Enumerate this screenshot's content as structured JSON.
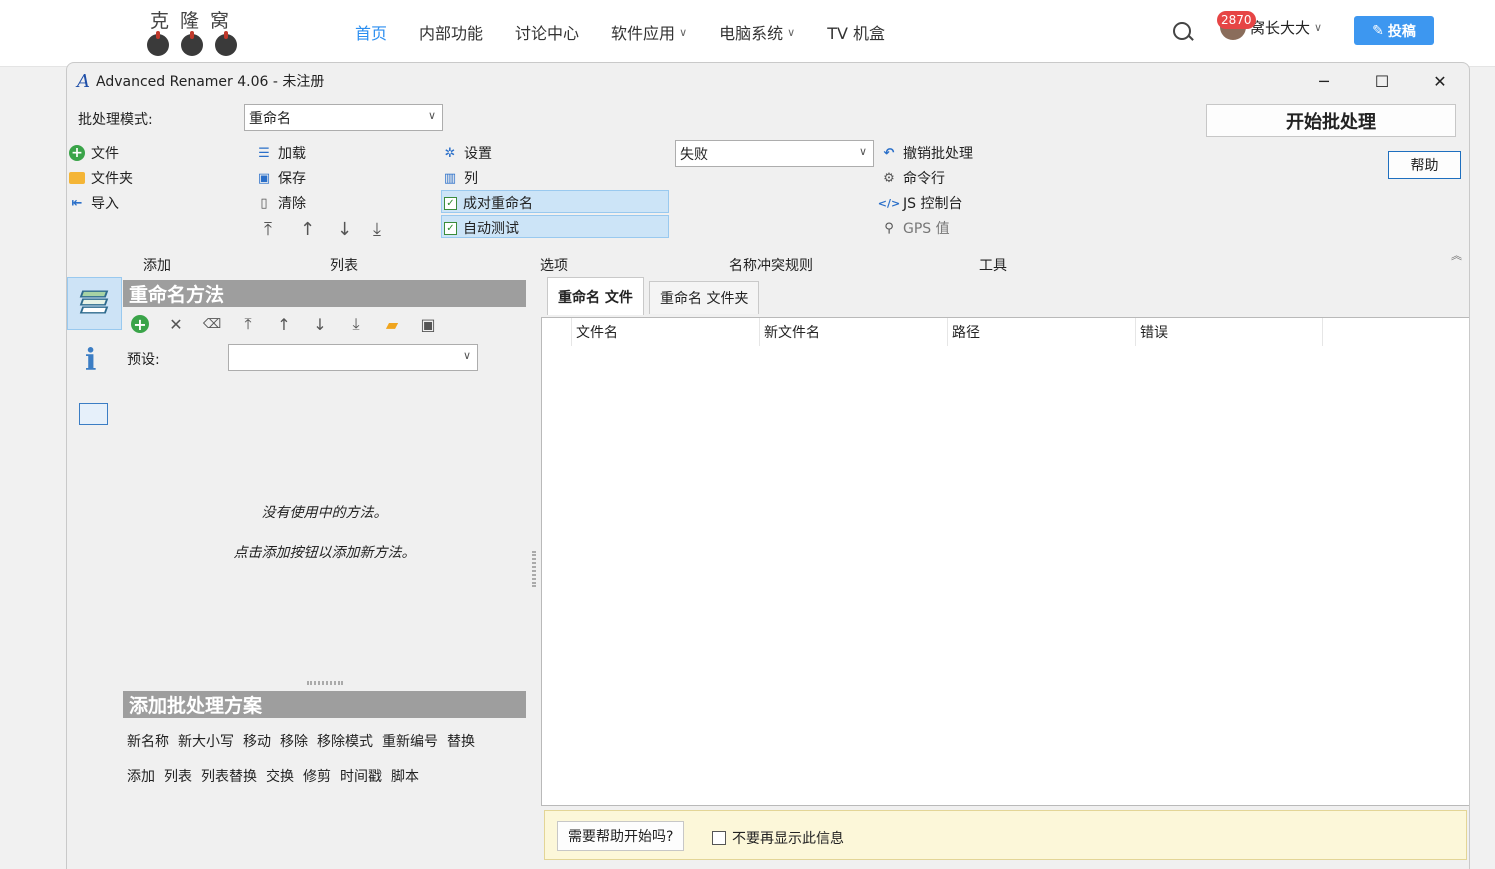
{
  "site": {
    "logo_text": "克隆窝",
    "nav": [
      {
        "label": "首页",
        "active": true,
        "has_menu": false
      },
      {
        "label": "内部功能",
        "active": false,
        "has_menu": false
      },
      {
        "label": "讨论中心",
        "active": false,
        "has_menu": false
      },
      {
        "label": "软件应用",
        "active": false,
        "has_menu": true
      },
      {
        "label": "电脑系统",
        "active": false,
        "has_menu": true
      },
      {
        "label": "TV 机盒",
        "active": false,
        "has_menu": false
      }
    ],
    "user_badge": "2870",
    "user_name": "窝长大大",
    "post_label": "投稿",
    "accent": "#2b8ef0"
  },
  "window": {
    "title": "Advanced Renamer 4.06 - 未注册",
    "batch_mode_label": "批处理模式:",
    "batch_mode_value": "重命名",
    "start_label": "开始批处理",
    "help_label": "帮助",
    "add_items": [
      "文件",
      "文件夹",
      "导入"
    ],
    "list_items": [
      "加载",
      "保存",
      "清除"
    ],
    "options_items": [
      "设置",
      "列"
    ],
    "checks": [
      "成对重命名",
      "自动测试"
    ],
    "conflict_value": "失败",
    "tools_items": [
      "撤销批处理",
      "命令行",
      "JS 控制台",
      "GPS 值"
    ],
    "sections": [
      "添加",
      "列表",
      "选项",
      "名称冲突规则",
      "工具"
    ]
  },
  "methods": {
    "title": "重命名方法",
    "preset_label": "预设:",
    "empty_line1": "没有使用中的方法。",
    "empty_line2": "点击添加按钮以添加新方法。",
    "add_title": "添加批处理方案",
    "row1": [
      "新名称",
      "新大小写",
      "移动",
      "移除",
      "移除模式",
      "重新编号",
      "替换"
    ],
    "row2": [
      "添加",
      "列表",
      "列表替换",
      "交换",
      "修剪",
      "时间戳",
      "脚本"
    ]
  },
  "files": {
    "tabs": [
      "重命名 文件",
      "重命名 文件夹"
    ],
    "columns": [
      "文件名",
      "新文件名",
      "路径",
      "错误"
    ],
    "need_help": "需要帮助开始吗?",
    "dont_show": "不要再显示此信息"
  }
}
